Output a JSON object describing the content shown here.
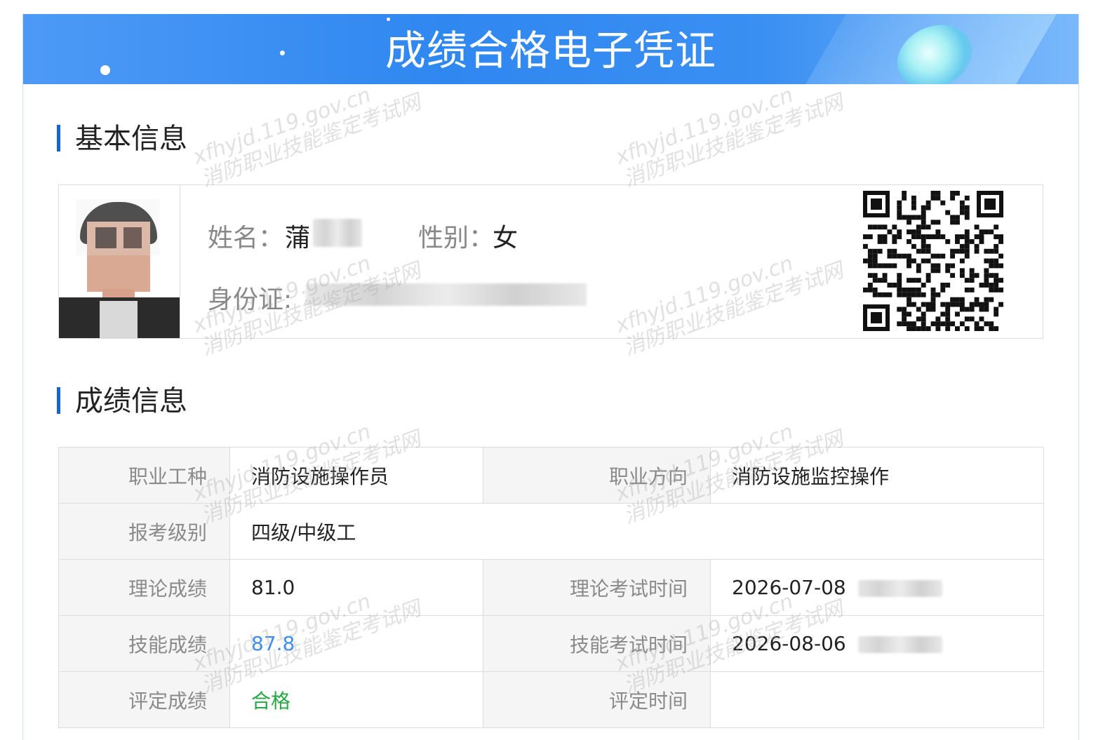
{
  "banner": {
    "title": "成绩合格电子凭证"
  },
  "basic_info": {
    "section_title": "基本信息",
    "name_label": "姓名：",
    "name_value": "蒲",
    "gender_label": "性别：",
    "gender_value": "女",
    "id_label": "身份证:"
  },
  "score_info": {
    "section_title": "成绩信息",
    "rows": [
      {
        "k1": "职业工种",
        "v1": "消防设施操作员",
        "k2": "职业方向",
        "v2": "消防设施监控操作"
      },
      {
        "k1": "报考级别",
        "v1": "四级/中级工"
      },
      {
        "k1": "理论成绩",
        "v1": "81.0",
        "k2": "理论考试时间",
        "v2": "2026-07-08"
      },
      {
        "k1": "技能成绩",
        "v1": "87.8",
        "k2": "技能考试时间",
        "v2": "2026-08-06"
      },
      {
        "k1": "评定成绩",
        "v1": "合格",
        "k2": "评定时间",
        "v2": ""
      }
    ]
  },
  "watermark": {
    "line1": "xfhyjd.119.gov.cn",
    "line2": "消防职业技能鉴定考试网"
  },
  "colors": {
    "accent": "#1565d8",
    "banner": "#2f87f0",
    "skill_score": "#3b8ef0",
    "pass": "#27a844"
  }
}
